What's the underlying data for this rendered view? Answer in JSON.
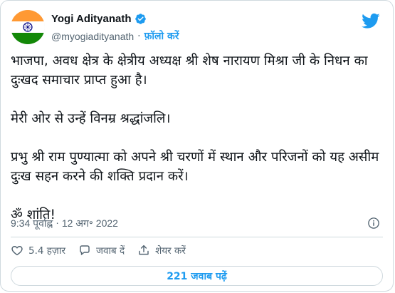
{
  "author": {
    "display_name": "Yogi Adityanath",
    "handle": "@myogiadityanath",
    "separator": "·",
    "follow_label": "फ़ॉलो करें"
  },
  "tweet": {
    "paragraphs": [
      "भाजपा, अवध क्षेत्र के क्षेत्रीय अध्यक्ष श्री शेष नारायण मिश्रा जी के निधन का दुःखद समाचार प्राप्त हुआ है।",
      "मेरी ओर से उन्हें विनम्र श्रद्धांजलि।",
      "प्रभु श्री राम पुण्यात्मा को अपने श्री चरणों में स्थान और परिजनों को यह असीम दुःख सहन करने की शक्ति प्रदान करें।",
      "ॐ शांति!"
    ],
    "time": "9:34 पूर्वाह्न",
    "time_separator": "·",
    "date": "12 अग॰ 2022"
  },
  "actions": {
    "like_count": "5.4 हज़ार",
    "reply_label": "जवाब दें",
    "share_label": "शेयर करें"
  },
  "replies_button": "221 जवाब पढ़ें",
  "colors": {
    "accent": "#1d9bf0",
    "text": "#0f1419",
    "secondary": "#536471",
    "border": "#cfd9de",
    "flag_saffron": "#ff9933",
    "flag_green": "#138808",
    "chakra_blue": "#000080"
  },
  "icons": {
    "avatar": "india-flag-avatar",
    "verified": "verified-badge-icon",
    "brand": "twitter-bird-icon",
    "info": "info-icon",
    "like": "heart-icon",
    "reply": "speech-bubble-icon",
    "share": "share-upload-icon"
  }
}
